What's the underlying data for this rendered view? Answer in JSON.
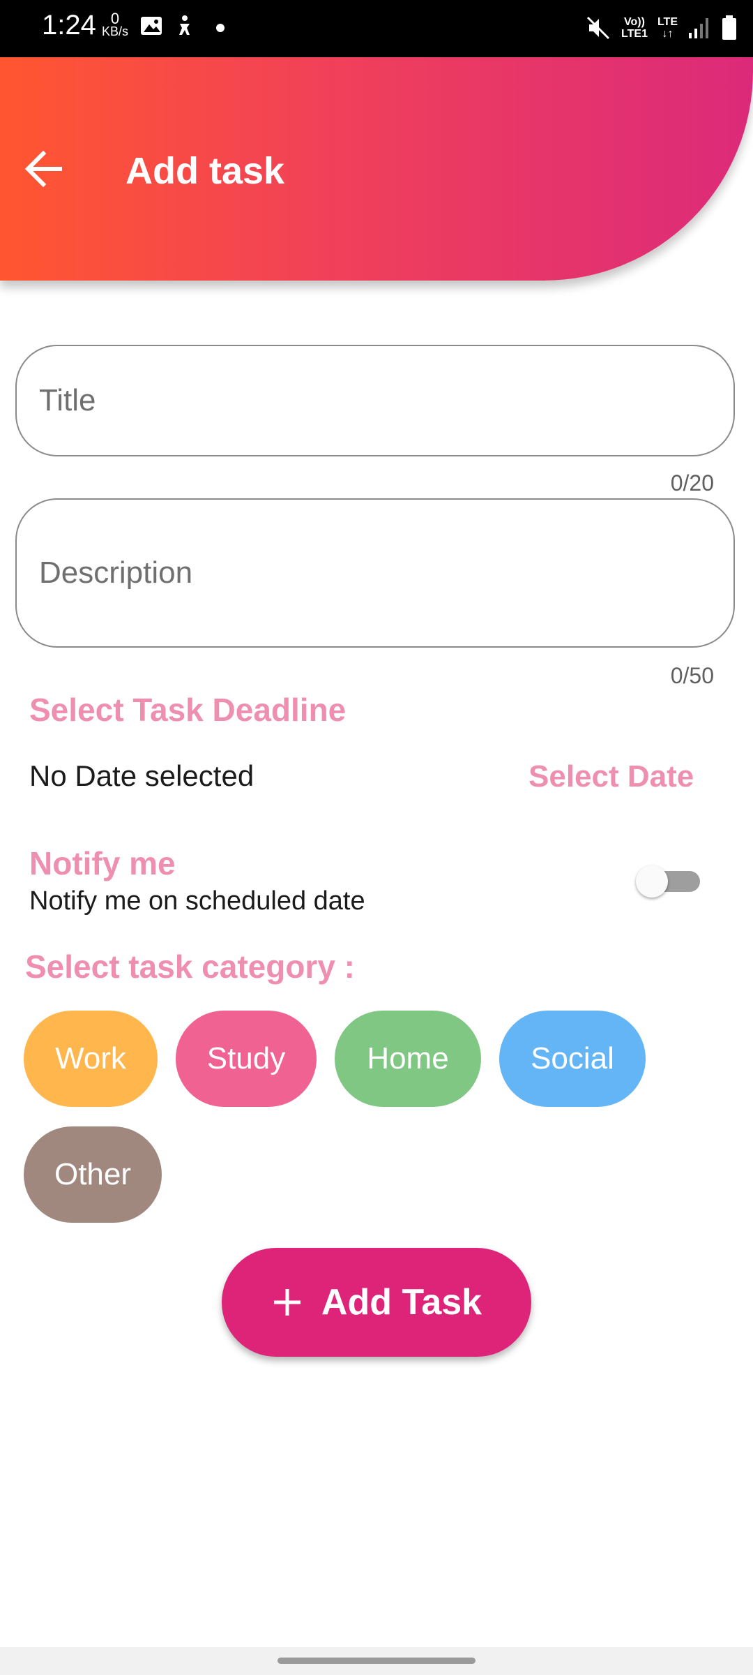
{
  "status_bar": {
    "time": "1:24",
    "data_rate_value": "0",
    "data_rate_unit": "KB/s",
    "network_label_top": "Vo))",
    "network_label_bottom": "LTE1",
    "lte_label": "LTE"
  },
  "header": {
    "title": "Add task",
    "back_icon": "arrow-left-icon",
    "gradient_start": "#ff5630",
    "gradient_end": "#dc2a7a"
  },
  "form": {
    "title_field": {
      "placeholder": "Title",
      "value": "",
      "counter": "0/20"
    },
    "description_field": {
      "placeholder": "Description",
      "value": "",
      "counter": "0/50"
    }
  },
  "deadline": {
    "section_title": "Select Task Deadline",
    "selected_text": "No Date selected",
    "select_button": "Select Date"
  },
  "notify": {
    "title": "Notify me",
    "subtitle": "Notify me on scheduled date",
    "enabled": false
  },
  "category": {
    "section_title": "Select task category :",
    "chips": [
      {
        "label": "Work",
        "color": "#ffb74d"
      },
      {
        "label": "Study",
        "color": "#f06292"
      },
      {
        "label": "Home",
        "color": "#81c784"
      },
      {
        "label": "Social",
        "color": "#64b5f6"
      },
      {
        "label": "Other",
        "color": "#a1887f"
      }
    ]
  },
  "actions": {
    "add_task_label": "Add Task",
    "add_task_color": "#dd2478",
    "icon": "plus-icon"
  },
  "accent_color": "#ef8fb0"
}
